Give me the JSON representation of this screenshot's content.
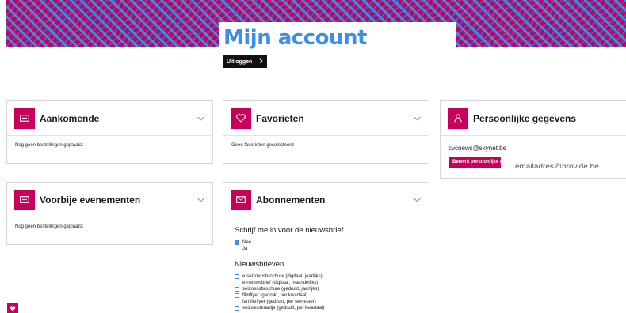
{
  "header": {
    "title": "Mijn account",
    "logout_label": "Uitloggen",
    "logout_icon": "chevron-right-icon"
  },
  "cards": {
    "upcoming": {
      "title": "Aankomende",
      "icon": "ticket-icon",
      "empty_text": "Nog geen bestellingen geplaatst"
    },
    "favorites": {
      "title": "Favorieten",
      "icon": "heart-icon",
      "empty_text": "Geen favorieten geselecteerd"
    },
    "personal": {
      "title": "Persoonlijke gegevens",
      "icon": "user-icon",
      "email": "cvcnews@skynet.be",
      "edit_label": "Bewerk persoonlijke gegevens",
      "overflow_text": "emailadres@provide.be"
    },
    "past": {
      "title": "Voorbije evenementen",
      "icon": "ticket-icon",
      "empty_text": "Nog geen bestellingen geplaatst"
    },
    "subscriptions": {
      "title": "Abonnementen",
      "icon": "envelope-icon",
      "newsletter_question": "Schrijf me in voor de nieuwsbrief",
      "options": [
        {
          "label": "Nee",
          "checked": true
        },
        {
          "label": "Ja",
          "checked": false
        }
      ],
      "newsletters_heading": "Nieuwsbrieven",
      "newsletters": [
        {
          "label": "e-seizoensbrochure (digitaal, jaarlijks)"
        },
        {
          "label": "e-nieuwsbrief (digitaal, maandelijks)"
        },
        {
          "label": "seizoensbrochure (gedrukt, jaarlijks)"
        },
        {
          "label": "filmflyer (gedrukt, per kwartaal)"
        },
        {
          "label": "familieflyer (gedrukt, per semester)"
        },
        {
          "label": "seizoenskrantje (gedrukt, per kwartaal)"
        }
      ]
    }
  },
  "colors": {
    "brand": "#c8005a",
    "accent": "#3b8fe8",
    "button_dark": "#111111"
  },
  "floating": {
    "icon": "heart-icon"
  }
}
